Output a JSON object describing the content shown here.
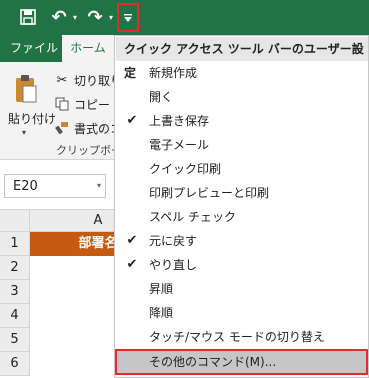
{
  "ribbon_tabs": {
    "file": "ファイル",
    "home": "ホーム"
  },
  "clipboard": {
    "paste": "貼り付け",
    "cut": "切り取り",
    "copy": "コピー",
    "format_painter": "書式のコ",
    "group_label": "クリップボード"
  },
  "name_box": {
    "value": "E20"
  },
  "grid": {
    "column_header": "A",
    "row_headers": [
      "1",
      "2",
      "3",
      "4",
      "5",
      "6"
    ],
    "cell_a1": "部署名"
  },
  "menu": {
    "header": "クイック アクセス ツール バーのユーザー設定",
    "items": [
      {
        "label": "新規作成",
        "checked": false
      },
      {
        "label": "開く",
        "checked": false
      },
      {
        "label": "上書き保存",
        "checked": true
      },
      {
        "label": "電子メール",
        "checked": false
      },
      {
        "label": "クイック印刷",
        "checked": false
      },
      {
        "label": "印刷プレビューと印刷",
        "checked": false
      },
      {
        "label": "スペル チェック",
        "checked": false
      },
      {
        "label": "元に戻す",
        "checked": true
      },
      {
        "label": "やり直し",
        "checked": true
      },
      {
        "label": "昇順",
        "checked": false
      },
      {
        "label": "降順",
        "checked": false
      },
      {
        "label": "タッチ/マウス モードの切り替え",
        "checked": false
      }
    ],
    "more_commands": "その他のコマンド(M)..."
  },
  "icons": {
    "check": "✔",
    "dropdown": "▾"
  },
  "colors": {
    "excel_green": "#217346",
    "header_cell_orange": "#c55a11",
    "highlight_red": "#e52a2a"
  }
}
